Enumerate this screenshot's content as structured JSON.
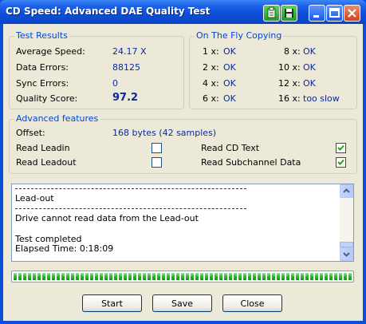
{
  "window": {
    "title": "CD Speed: Advanced DAE Quality Test"
  },
  "icons": {
    "titlebar_left_1": "clipboard-icon",
    "titlebar_left_2": "save-disk-icon",
    "minimize": "minimize-icon",
    "maximize": "maximize-icon",
    "close": "close-icon"
  },
  "test_results": {
    "title": "Test Results",
    "rows": [
      {
        "label": "Average Speed:",
        "value": "24.17 X"
      },
      {
        "label": "Data Errors:",
        "value": "88125"
      },
      {
        "label": "Sync Errors:",
        "value": "0"
      },
      {
        "label": "Quality Score:",
        "value": "97.2"
      }
    ]
  },
  "on_the_fly": {
    "title": "On The Fly Copying",
    "items": [
      {
        "label": "1 x:",
        "value": "OK"
      },
      {
        "label": "8 x:",
        "value": "OK"
      },
      {
        "label": "2 x:",
        "value": "OK"
      },
      {
        "label": "10 x:",
        "value": "OK"
      },
      {
        "label": "4 x:",
        "value": "OK"
      },
      {
        "label": "12 x:",
        "value": "OK"
      },
      {
        "label": "6 x:",
        "value": "OK"
      },
      {
        "label": "16 x:",
        "value": "too slow"
      }
    ]
  },
  "advanced": {
    "title": "Advanced features",
    "offset_label": "Offset:",
    "offset_value": "168 bytes (42 samples)",
    "read_leadin": {
      "label": "Read Leadin",
      "checked": false
    },
    "read_leadout": {
      "label": "Read Leadout",
      "checked": false
    },
    "read_cd_text": {
      "label": "Read CD Text",
      "checked": true
    },
    "read_subchannel": {
      "label": "Read Subchannel Data",
      "checked": true
    }
  },
  "log": {
    "lines": [
      "Lead-out",
      "Drive cannot read data from the Lead-out",
      "Test completed",
      "Elapsed Time:  0:18:09"
    ]
  },
  "progress": {
    "fraction": 1.0,
    "color": "#2fb52f"
  },
  "buttons": {
    "start": "Start",
    "save": "Save",
    "close": "Close"
  }
}
